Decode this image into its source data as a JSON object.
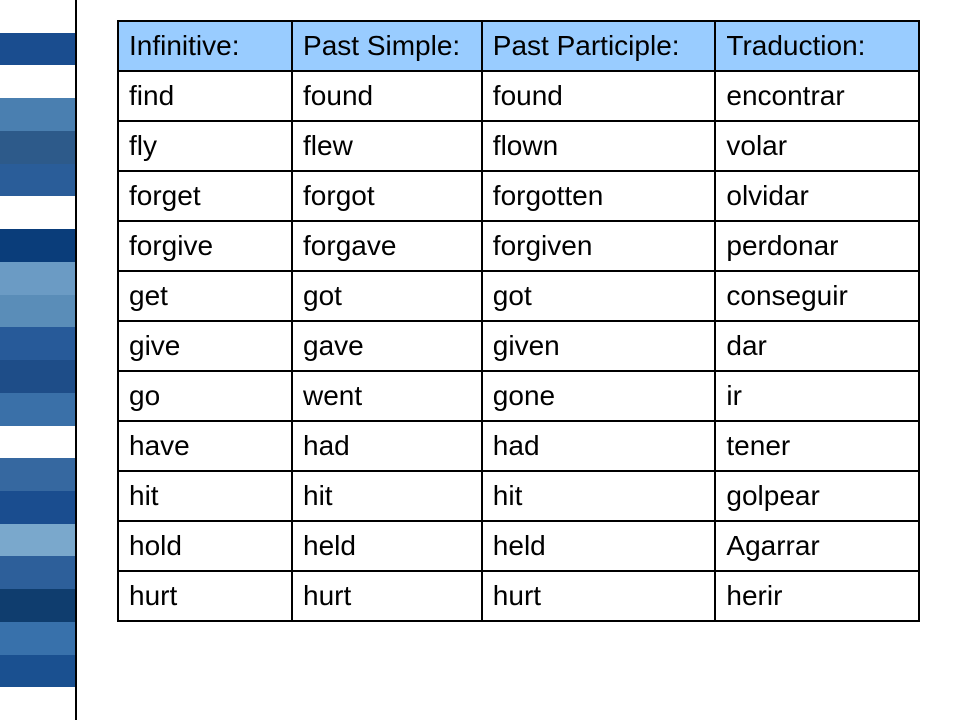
{
  "chart_data": {
    "type": "table",
    "headers": [
      "Infinitive:",
      "Past Simple:",
      "Past Participle:",
      "Traduction:"
    ],
    "rows": [
      [
        "find",
        "found",
        "found",
        "encontrar"
      ],
      [
        "fly",
        "flew",
        "flown",
        "volar"
      ],
      [
        "forget",
        "forgot",
        "forgotten",
        "olvidar"
      ],
      [
        "forgive",
        "forgave",
        "forgiven",
        "perdonar"
      ],
      [
        "get",
        "got",
        "got",
        "conseguir"
      ],
      [
        "give",
        "gave",
        "given",
        "dar"
      ],
      [
        "go",
        "went",
        "gone",
        "ir"
      ],
      [
        "have",
        "had",
        "had",
        "tener"
      ],
      [
        "hit",
        "hit",
        "hit",
        "golpear"
      ],
      [
        "hold",
        "held",
        "held",
        "Agarrar"
      ],
      [
        "hurt",
        "hurt",
        "hurt",
        "herir"
      ]
    ]
  },
  "sidebar_colors": [
    "#ffffff",
    "#1a4d8f",
    "#ffffff",
    "#4a7fb0",
    "#2d5a8a",
    "#2a5d99",
    "#ffffff",
    "#0a3d7a",
    "#6b9bc4",
    "#5a8db8",
    "#275a99",
    "#1e4d88",
    "#3a70a8",
    "#ffffff",
    "#3668a0",
    "#1a4d8f",
    "#7aa8cc",
    "#2d5f9a",
    "#0f3d6e",
    "#3871ab",
    "#1a5090",
    "#ffffff"
  ],
  "headers": {
    "h0": "Infinitive:",
    "h1": "Past Simple:",
    "h2": "Past Participle:",
    "h3": "Traduction:"
  },
  "rows": {
    "r0": {
      "c0": "find",
      "c1": "found",
      "c2": "found",
      "c3": "encontrar"
    },
    "r1": {
      "c0": "fly",
      "c1": "flew",
      "c2": "flown",
      "c3": "volar"
    },
    "r2": {
      "c0": "forget",
      "c1": "forgot",
      "c2": "forgotten",
      "c3": "olvidar"
    },
    "r3": {
      "c0": "forgive",
      "c1": "forgave",
      "c2": "forgiven",
      "c3": "perdonar"
    },
    "r4": {
      "c0": "get",
      "c1": "got",
      "c2": "got",
      "c3": "conseguir"
    },
    "r5": {
      "c0": "give",
      "c1": "gave",
      "c2": "given",
      "c3": "dar"
    },
    "r6": {
      "c0": "go",
      "c1": "went",
      "c2": "gone",
      "c3": "ir"
    },
    "r7": {
      "c0": "have",
      "c1": "had",
      "c2": "had",
      "c3": "tener"
    },
    "r8": {
      "c0": "hit",
      "c1": "hit",
      "c2": "hit",
      "c3": "golpear"
    },
    "r9": {
      "c0": "hold",
      "c1": "held",
      "c2": "held",
      "c3": "Agarrar"
    },
    "r10": {
      "c0": "hurt",
      "c1": "hurt",
      "c2": "hurt",
      "c3": "herir"
    }
  }
}
